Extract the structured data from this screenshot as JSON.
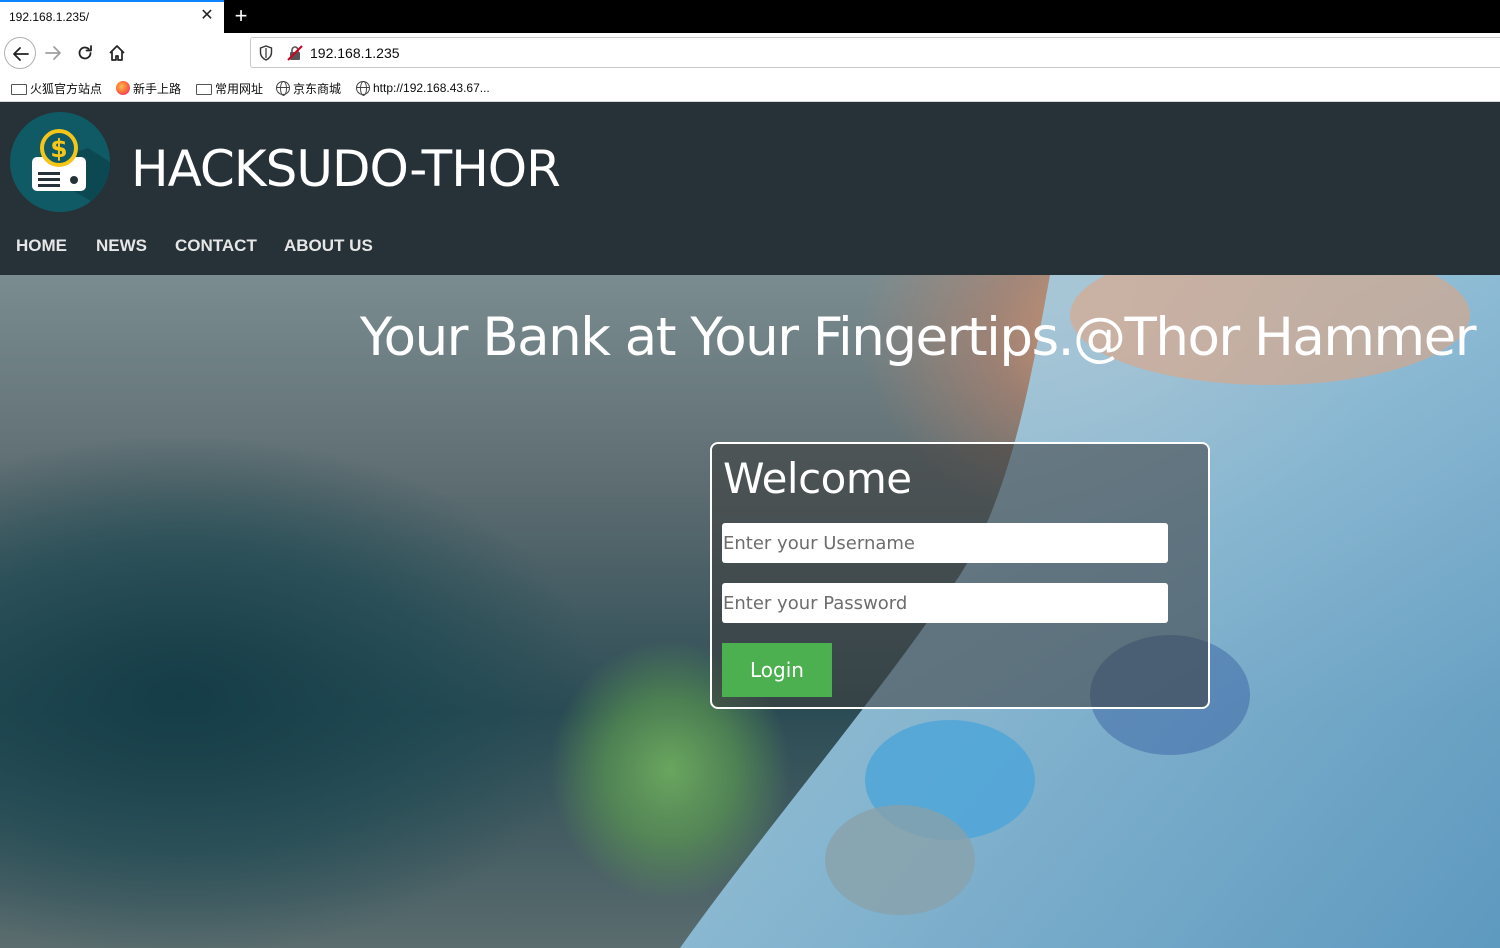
{
  "browser": {
    "tab_title": "192.168.1.235/",
    "tab_close_glyph": "✕",
    "new_tab_glyph": "+",
    "url": "192.168.1.235",
    "bookmarks": [
      {
        "label": "火狐官方站点",
        "icon": "folder-icon"
      },
      {
        "label": "新手上路",
        "icon": "firefox-icon"
      },
      {
        "label": "常用网址",
        "icon": "folder-icon"
      },
      {
        "label": "京东商城",
        "icon": "globe-icon"
      },
      {
        "label": "http://192.168.43.67...",
        "icon": "globe-icon"
      }
    ]
  },
  "site": {
    "brand": "HACKSUDO-THOR",
    "menu": [
      "HOME",
      "NEWS",
      "CONTACT",
      "ABOUT US"
    ],
    "hero_title": "Your Bank at Your Fingertips.@Thor Hammer",
    "login": {
      "heading": "Welcome",
      "username_placeholder": "Enter your Username",
      "password_placeholder": "Enter your Password",
      "button_label": "Login"
    }
  },
  "colors": {
    "header_bg": "#263238",
    "login_button": "#4caf50",
    "logo_bg": "#105a66",
    "logo_coin": "#f5c518"
  }
}
